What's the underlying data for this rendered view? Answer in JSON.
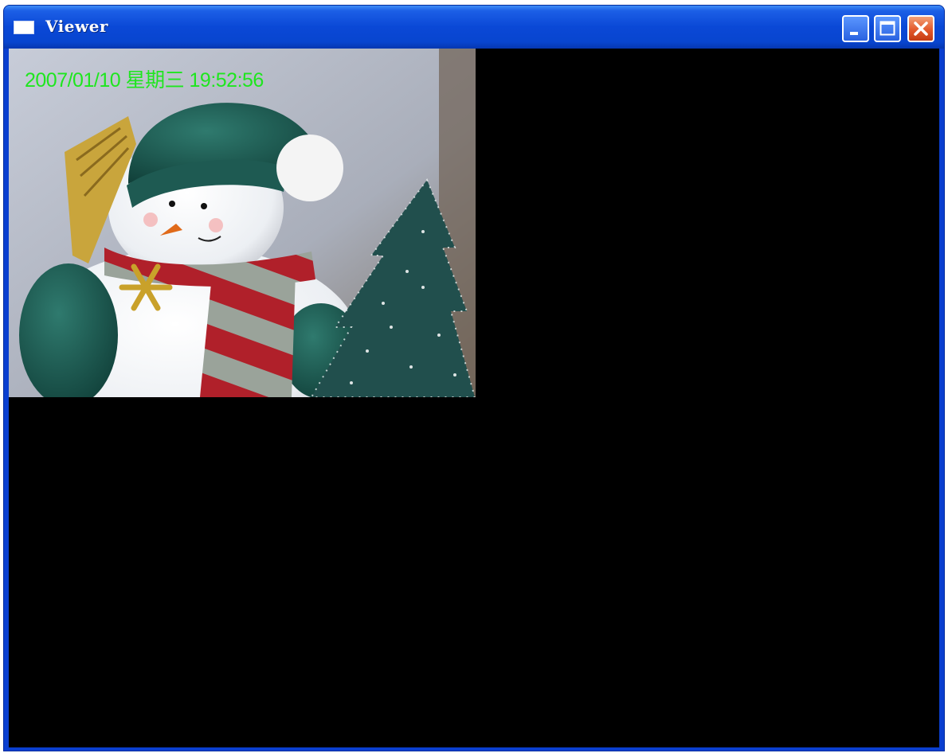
{
  "window": {
    "title": "Viewer",
    "icons": {
      "app": "window-icon",
      "minimize": "minimize-icon",
      "maximize": "maximize-icon",
      "close": "close-icon"
    }
  },
  "video": {
    "osd_timestamp": "2007/01/10 星期三 19:52:56",
    "osd_color": "#1ee61e",
    "subject": "snowman-plush-with-christmas-tree"
  },
  "colors": {
    "titlebar": "#0a48d6",
    "close_button": "#e3592c",
    "client_background": "#000000"
  }
}
